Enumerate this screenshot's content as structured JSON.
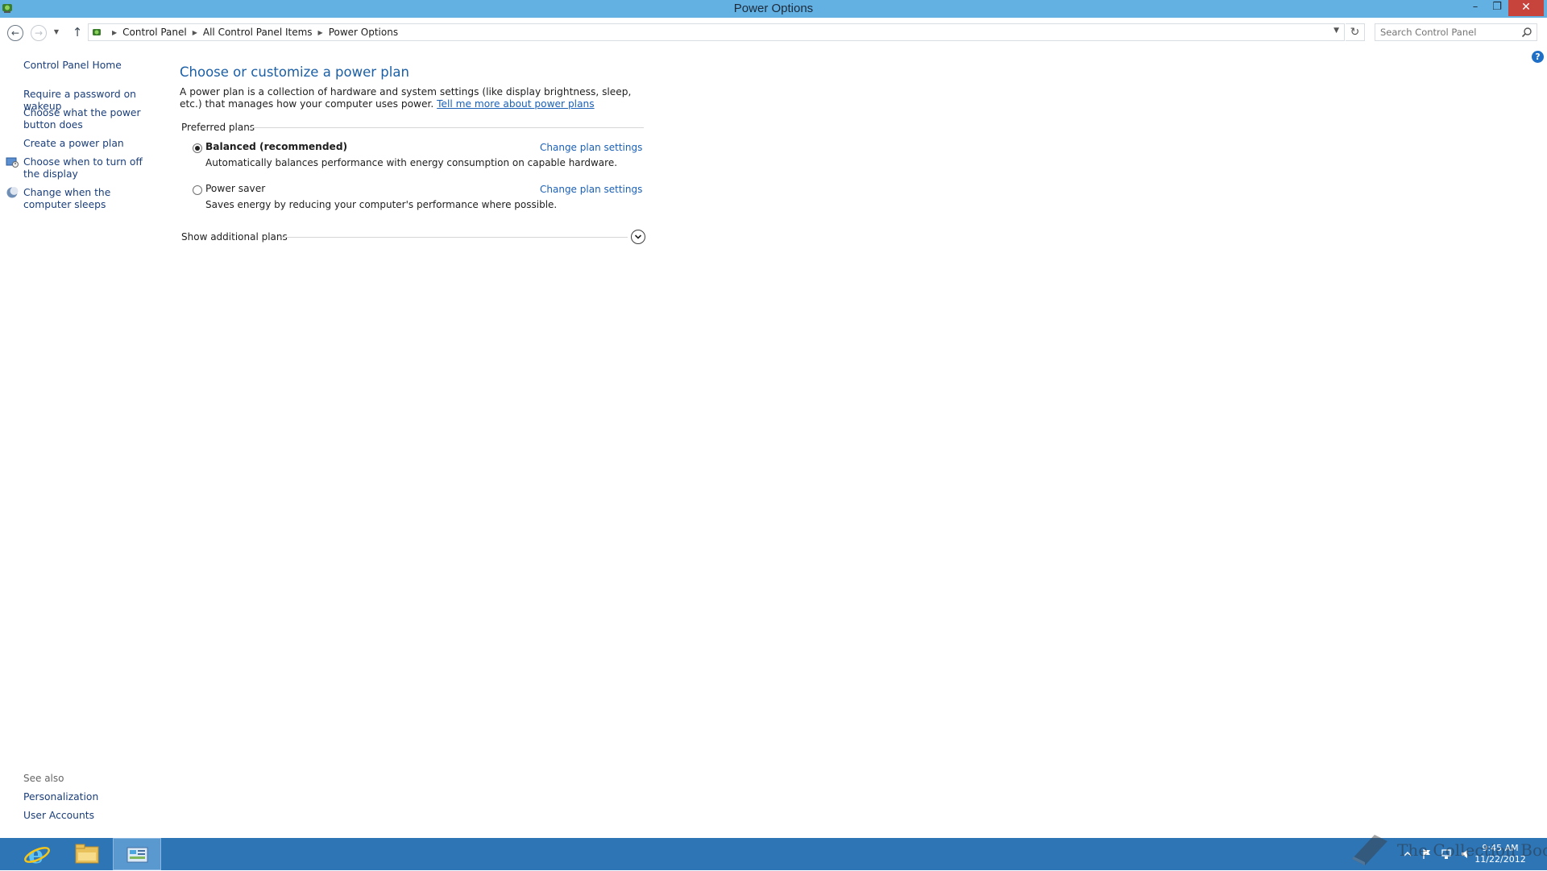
{
  "window": {
    "title": "Power Options",
    "controls": [
      "minimize",
      "restore",
      "close"
    ]
  },
  "navigation": {
    "breadcrumbs": [
      "Control Panel",
      "All Control Panel Items",
      "Power Options"
    ],
    "search_placeholder": "Search Control Panel"
  },
  "sidebar": {
    "home": "Control Panel Home",
    "tasks": [
      {
        "label": "Require a password on wakeup",
        "icon": "none"
      },
      {
        "label": "Choose what the power button does",
        "icon": "none"
      },
      {
        "label": "Create a power plan",
        "icon": "none"
      },
      {
        "label": "Choose when to turn off the display",
        "icon": "monitor-shield-icon"
      },
      {
        "label": "Change when the computer sleeps",
        "icon": "moon-icon"
      }
    ],
    "see_also_title": "See also",
    "see_also": [
      "Personalization",
      "User Accounts"
    ]
  },
  "main": {
    "heading": "Choose or customize a power plan",
    "intro": "A power plan is a collection of hardware and system settings (like display brightness, sleep, etc.) that manages how your computer uses power.",
    "intro_link": "Tell me more about power plans",
    "group_label": "Preferred plans",
    "plans": [
      {
        "name": "Balanced (recommended)",
        "description": "Automatically balances performance with energy consumption on capable hardware.",
        "selected": true,
        "change_link": "Change plan settings"
      },
      {
        "name": "Power saver",
        "description": "Saves energy by reducing your computer's performance where possible.",
        "selected": false,
        "change_link": "Change plan settings"
      }
    ],
    "show_additional": "Show additional plans"
  },
  "taskbar": {
    "apps": [
      "internet-explorer-icon",
      "file-explorer-icon",
      "control-panel-icon"
    ],
    "active_app": "control-panel-icon",
    "clock_time": "9:45 AM",
    "clock_date": "11/22/2012"
  },
  "watermark": "The Collection Book",
  "colors": {
    "titlebar": "#63b0e3",
    "taskbar": "#2e75b6",
    "link": "#1a60b7",
    "heading": "#1b5fa6",
    "close_button": "#c7443d"
  }
}
